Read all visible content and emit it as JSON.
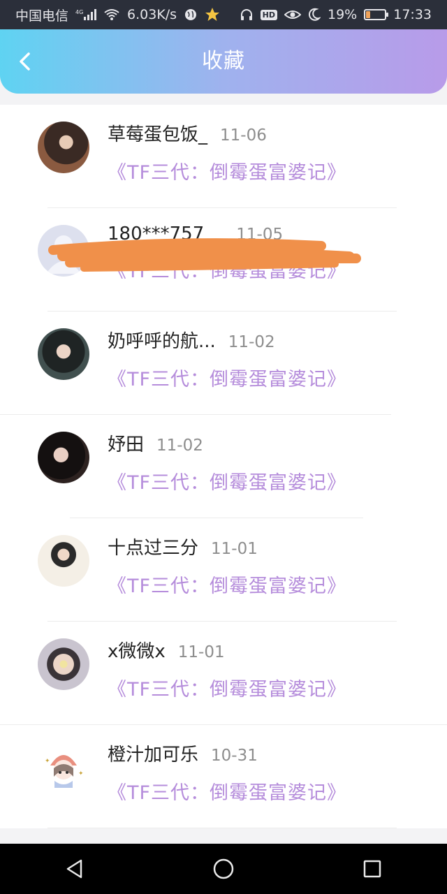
{
  "status_bar": {
    "carrier": "中国电信",
    "network": "4G",
    "speed": "6.03K/s",
    "battery": "19%",
    "battery_level": 0.19,
    "time": "17:33"
  },
  "header": {
    "title": "收藏",
    "back_icon": "chevron-left-icon"
  },
  "favorites": [
    {
      "name": "草莓蛋包饭_",
      "date": "11-06",
      "book": "《TF三代：倒霉蛋富婆记》",
      "avatar_color": "#6b4a3e"
    },
    {
      "name": "180***757",
      "date": "11-05",
      "book": "《TF三代：倒霉蛋富婆记》",
      "avatar_color": "#d7dbec"
    },
    {
      "name": "奶呼呼的航...",
      "date": "11-02",
      "book": "《TF三代：倒霉蛋富婆记》",
      "avatar_color": "#2e3a3a"
    },
    {
      "name": "妤田",
      "date": "11-02",
      "book": "《TF三代：倒霉蛋富婆记》",
      "avatar_color": "#2a1f1e"
    },
    {
      "name": "十点过三分",
      "date": "11-01",
      "book": "《TF三代：倒霉蛋富婆记》",
      "avatar_color": "#e9e2d6"
    },
    {
      "name": "x微微x",
      "date": "11-01",
      "book": "《TF三代：倒霉蛋富婆记》",
      "avatar_color": "#c7c3cc"
    },
    {
      "name": "橙汁加可乐",
      "date": "10-31",
      "book": "《TF三代：倒霉蛋富婆记》",
      "avatar_color": "#f7eef3"
    }
  ],
  "colors": {
    "header_gradient_start": "#5fd3f2",
    "header_gradient_end": "#b89be9",
    "book_title": "#b58cdb",
    "redaction": "#f0904a"
  }
}
